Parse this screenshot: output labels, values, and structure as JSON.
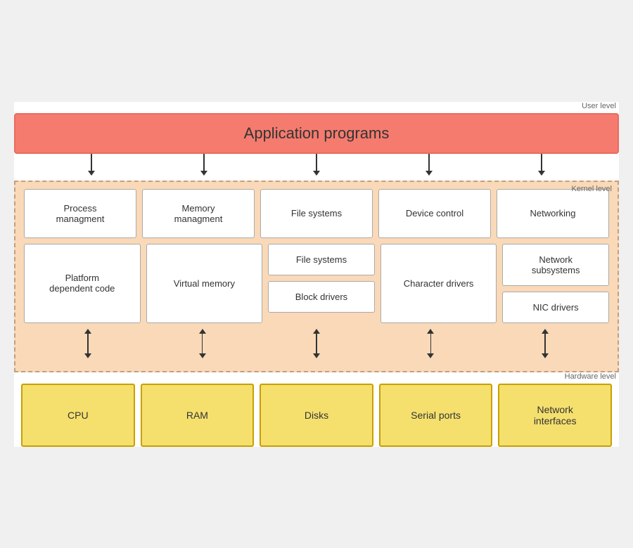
{
  "labels": {
    "user_level": "User level",
    "kernel_level": "Kernel level",
    "hardware_level": "Hardware level"
  },
  "app_bar": {
    "text": "Application programs"
  },
  "kernel_top": [
    {
      "id": "process-mgmt",
      "text": "Process\nmanagment"
    },
    {
      "id": "memory-mgmt",
      "text": "Memory\nmanagment"
    },
    {
      "id": "file-systems-top",
      "text": "File systems"
    },
    {
      "id": "device-control",
      "text": "Device control"
    },
    {
      "id": "networking",
      "text": "Networking"
    }
  ],
  "kernel_bottom": {
    "platform": "Platform\ndependent code",
    "virtual_memory": "Virtual memory",
    "file_systems": "File systems",
    "block_drivers": "Block drivers",
    "character_drivers": "Character drivers",
    "network_subsystems": "Network\nsubsystems",
    "nic_drivers": "NIC drivers"
  },
  "hardware": [
    {
      "id": "cpu",
      "text": "CPU"
    },
    {
      "id": "ram",
      "text": "RAM"
    },
    {
      "id": "disks",
      "text": "Disks"
    },
    {
      "id": "serial-ports",
      "text": "Serial ports"
    },
    {
      "id": "network-interfaces",
      "text": "Network\ninterfaces"
    }
  ]
}
